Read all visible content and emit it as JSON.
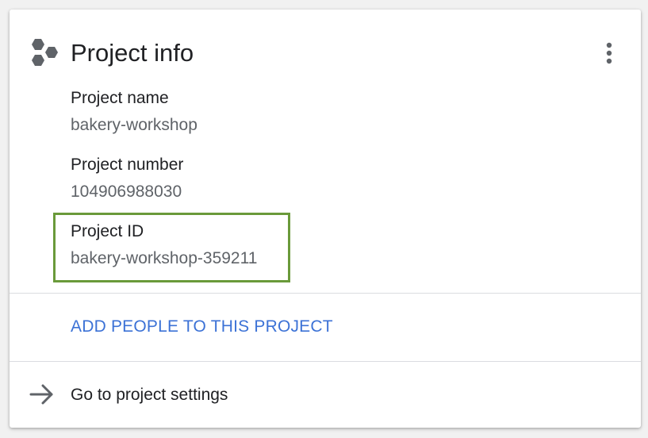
{
  "card": {
    "title": "Project info",
    "header_icon": "hexagon-cluster-icon",
    "more_icon": "more-vert-icon"
  },
  "fields": [
    {
      "label": "Project name",
      "value": "bakery-workshop"
    },
    {
      "label": "Project number",
      "value": "104906988030"
    },
    {
      "label": "Project ID",
      "value": "bakery-workshop-359211"
    }
  ],
  "actions": {
    "add_people_label": "ADD PEOPLE TO THIS PROJECT",
    "settings_label": "Go to project settings",
    "settings_icon": "arrow-right-icon"
  },
  "colors": {
    "link": "#3c72d6",
    "highlight_border": "#6a9a3a",
    "secondary_text": "#5f6368",
    "icon_gray": "#5f6368"
  }
}
